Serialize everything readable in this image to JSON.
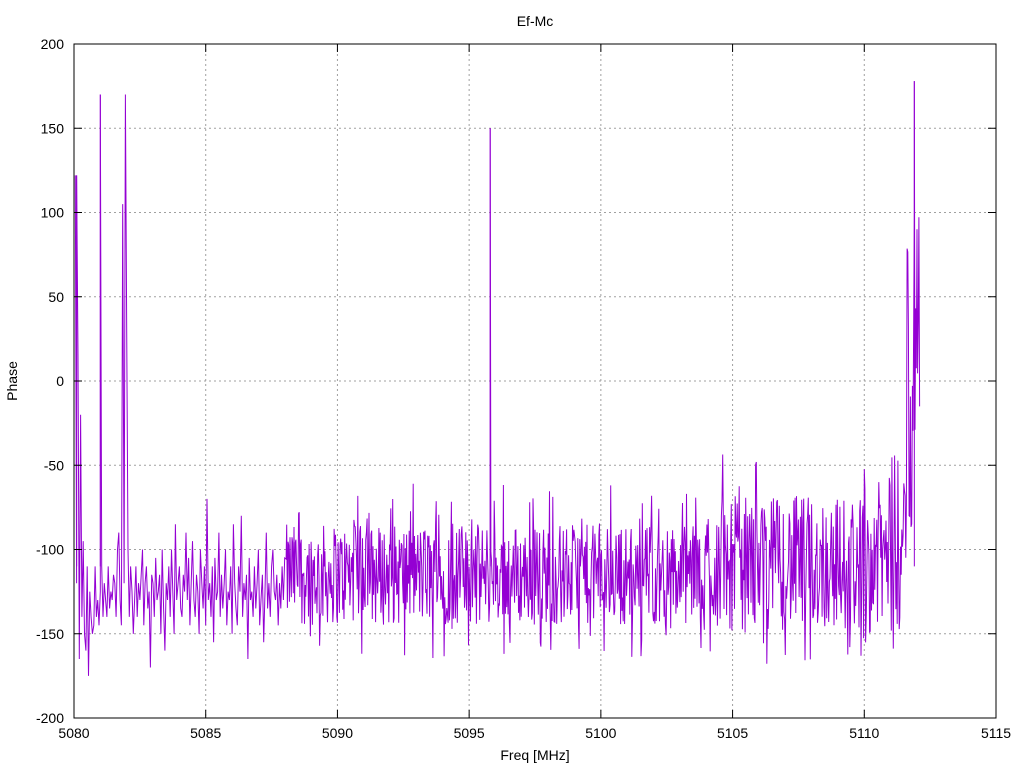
{
  "chart_data": {
    "type": "line",
    "title": "Ef-Mc",
    "xlabel": "Freq [MHz]",
    "ylabel": "Phase",
    "xlim": [
      5080,
      5115
    ],
    "ylim": [
      -200,
      200
    ],
    "x_ticks": [
      5080,
      5085,
      5090,
      5095,
      5100,
      5105,
      5110,
      5115
    ],
    "y_ticks": [
      -200,
      -150,
      -100,
      -50,
      0,
      50,
      100,
      150,
      200
    ],
    "grid": true,
    "series_color": "#9400d3",
    "series": [
      {
        "x_start": 5080.05,
        "x_step": 0.05,
        "values": [
          122,
          -120,
          15,
          -165,
          -20,
          -140,
          -95,
          -150,
          -160,
          -110,
          -175,
          -125,
          -140,
          -150,
          -145,
          -110,
          -140,
          -130,
          -145,
          -125,
          -110,
          -140,
          -120,
          -130,
          -140,
          -110,
          -135,
          -125,
          -130,
          -115,
          -120,
          -140,
          -100,
          -90,
          -130,
          -145,
          105,
          -120,
          170,
          30,
          -100,
          -140,
          -110,
          -125,
          -150,
          -130,
          -110,
          -140,
          -120,
          -130,
          -115,
          -100,
          -145,
          -120,
          -110,
          -135,
          -125,
          -170,
          -115,
          -120,
          -140,
          -105,
          -130,
          -125,
          -115,
          -150,
          -100,
          -135,
          -160,
          -120,
          -130,
          -110,
          -140,
          -100,
          -125,
          -150,
          -85,
          -130,
          -120,
          -110,
          -135,
          -140,
          -115,
          -125,
          -90,
          -130,
          -105,
          -145,
          -120,
          -95,
          -130,
          -140,
          -115,
          -125,
          -150,
          -100,
          -120,
          -135,
          -110,
          -145,
          -70,
          -130,
          -120,
          -140,
          -110,
          -155,
          -105,
          -130,
          -125,
          -90,
          -140,
          -115,
          -135,
          -120,
          -100,
          -145,
          -125,
          -130,
          -110,
          -150,
          -85,
          -120,
          -135,
          -145,
          -110,
          -125,
          -80,
          -140,
          -120,
          -130,
          -115,
          -165,
          -105,
          -130,
          -125,
          -140,
          -110,
          -135,
          -120,
          -100,
          -145,
          -130,
          -115,
          -155,
          -125,
          -90,
          -135,
          -120,
          -140,
          -110,
          -100,
          -125,
          -130,
          -115,
          -145,
          -120,
          -135,
          -110,
          -130,
          -105
        ]
      }
    ],
    "spikes": [
      {
        "x": 5080.1,
        "y": 122
      },
      {
        "x": 5081.0,
        "y": 170
      },
      {
        "x": 5095.8,
        "y": 150
      },
      {
        "x": 5111.9,
        "y": 178
      }
    ]
  }
}
